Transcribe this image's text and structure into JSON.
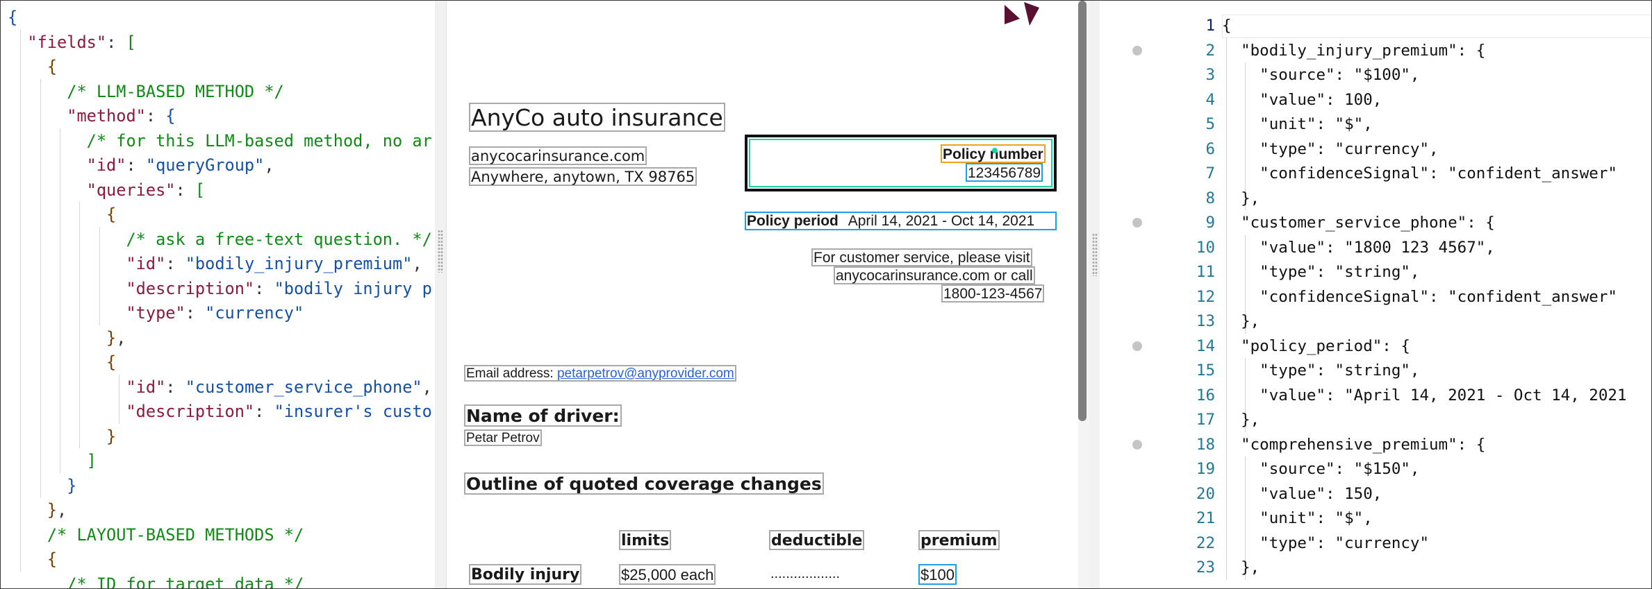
{
  "left_code": {
    "lines": [
      [
        {
          "c": "brace",
          "t": "{"
        }
      ],
      [
        {
          "c": "p",
          "t": "  "
        },
        {
          "c": "key",
          "t": "\"fields\""
        },
        {
          "c": "p",
          "t": ": "
        },
        {
          "c": "br2",
          "t": "["
        }
      ],
      [
        {
          "c": "p",
          "t": "    "
        },
        {
          "c": "br1",
          "t": "{"
        }
      ],
      [
        {
          "c": "p",
          "t": "      "
        },
        {
          "c": "cmt",
          "t": "/* LLM-BASED METHOD */"
        }
      ],
      [
        {
          "c": "p",
          "t": "      "
        },
        {
          "c": "key",
          "t": "\"method\""
        },
        {
          "c": "p",
          "t": ": "
        },
        {
          "c": "br3",
          "t": "{"
        }
      ],
      [
        {
          "c": "p",
          "t": "        "
        },
        {
          "c": "cmt",
          "t": "/* for this LLM-based method, no ar"
        }
      ],
      [
        {
          "c": "p",
          "t": "        "
        },
        {
          "c": "key",
          "t": "\"id\""
        },
        {
          "c": "p",
          "t": ": "
        },
        {
          "c": "str",
          "t": "\"queryGroup\""
        },
        {
          "c": "p",
          "t": ","
        }
      ],
      [
        {
          "c": "p",
          "t": "        "
        },
        {
          "c": "key",
          "t": "\"queries\""
        },
        {
          "c": "p",
          "t": ": "
        },
        {
          "c": "br2",
          "t": "["
        }
      ],
      [
        {
          "c": "p",
          "t": "          "
        },
        {
          "c": "br1",
          "t": "{"
        }
      ],
      [
        {
          "c": "p",
          "t": "            "
        },
        {
          "c": "cmt",
          "t": "/* ask a free-text question. */"
        }
      ],
      [
        {
          "c": "p",
          "t": "            "
        },
        {
          "c": "key",
          "t": "\"id\""
        },
        {
          "c": "p",
          "t": ": "
        },
        {
          "c": "str",
          "t": "\"bodily_injury_premium\""
        },
        {
          "c": "p",
          "t": ","
        }
      ],
      [
        {
          "c": "p",
          "t": "            "
        },
        {
          "c": "key",
          "t": "\"description\""
        },
        {
          "c": "p",
          "t": ": "
        },
        {
          "c": "str",
          "t": "\"bodily injury p"
        }
      ],
      [
        {
          "c": "p",
          "t": "            "
        },
        {
          "c": "key",
          "t": "\"type\""
        },
        {
          "c": "p",
          "t": ": "
        },
        {
          "c": "str",
          "t": "\"currency\""
        }
      ],
      [
        {
          "c": "p",
          "t": "          "
        },
        {
          "c": "br1",
          "t": "}"
        },
        {
          "c": "p",
          "t": ","
        }
      ],
      [
        {
          "c": "p",
          "t": "          "
        },
        {
          "c": "br1",
          "t": "{"
        }
      ],
      [
        {
          "c": "p",
          "t": "            "
        },
        {
          "c": "key",
          "t": "\"id\""
        },
        {
          "c": "p",
          "t": ": "
        },
        {
          "c": "str",
          "t": "\"customer_service_phone\""
        },
        {
          "c": "p",
          "t": ","
        }
      ],
      [
        {
          "c": "p",
          "t": "            "
        },
        {
          "c": "key",
          "t": "\"description\""
        },
        {
          "c": "p",
          "t": ": "
        },
        {
          "c": "str",
          "t": "\"insurer's custo"
        }
      ],
      [
        {
          "c": "p",
          "t": "          "
        },
        {
          "c": "br1",
          "t": "}"
        }
      ],
      [
        {
          "c": "p",
          "t": "        "
        },
        {
          "c": "br2",
          "t": "]"
        }
      ],
      [
        {
          "c": "p",
          "t": "      "
        },
        {
          "c": "br3",
          "t": "}"
        }
      ],
      [
        {
          "c": "p",
          "t": "    "
        },
        {
          "c": "br1",
          "t": "}"
        },
        {
          "c": "p",
          "t": ","
        }
      ],
      [
        {
          "c": "p",
          "t": "    "
        },
        {
          "c": "cmt",
          "t": "/* LAYOUT-BASED METHODS */"
        }
      ],
      [
        {
          "c": "p",
          "t": "    "
        },
        {
          "c": "br1",
          "t": "{"
        }
      ],
      [
        {
          "c": "p",
          "t": "      "
        },
        {
          "c": "cmt",
          "t": "/* ID for target data */"
        }
      ]
    ]
  },
  "document": {
    "company_name": "AnyCo auto insurance",
    "website": "anycocarinsurance.com",
    "address": "Anywhere, anytown, TX 98765",
    "policy_number_label": "Policy number",
    "policy_number_value": "123456789",
    "policy_period_label": "Policy period",
    "policy_period_value": "April 14, 2021 - Oct 14, 2021",
    "customer_service_line1": "For customer service, please visit",
    "customer_service_line2": "anycocarinsurance.com or call",
    "customer_service_line3": "1800-123-4567",
    "email_label": "Email address: ",
    "email_value": "petarpetrov@anyprovider.com",
    "driver_label": "Name of driver:",
    "driver_name": "Petar Petrov",
    "outline_heading": "Outline of quoted coverage changes",
    "table_headers": [
      "limits",
      "deductible",
      "premium"
    ],
    "row_label": "Bodily injury",
    "row_limits": "$25,000 each",
    "row_deductible": "..................",
    "row_premium": "$100",
    "colors": {
      "highlight_blue": "#1ea0e6",
      "highlight_orange": "#f0a020",
      "policy_box_green": "#1fd3a0",
      "logo": "#5a1030"
    }
  },
  "right_code": {
    "active_line": 1,
    "fold_lines": [
      2,
      9,
      14,
      18
    ],
    "lines": [
      {
        "n": 1,
        "t": "{"
      },
      {
        "n": 2,
        "t": "  \"bodily_injury_premium\": {"
      },
      {
        "n": 3,
        "t": "    \"source\": \"$100\","
      },
      {
        "n": 4,
        "t": "    \"value\": 100,"
      },
      {
        "n": 5,
        "t": "    \"unit\": \"$\","
      },
      {
        "n": 6,
        "t": "    \"type\": \"currency\","
      },
      {
        "n": 7,
        "t": "    \"confidenceSignal\": \"confident_answer\""
      },
      {
        "n": 8,
        "t": "  },"
      },
      {
        "n": 9,
        "t": "  \"customer_service_phone\": {"
      },
      {
        "n": 10,
        "t": "    \"value\": \"1800 123 4567\","
      },
      {
        "n": 11,
        "t": "    \"type\": \"string\","
      },
      {
        "n": 12,
        "t": "    \"confidenceSignal\": \"confident_answer\""
      },
      {
        "n": 13,
        "t": "  },"
      },
      {
        "n": 14,
        "t": "  \"policy_period\": {"
      },
      {
        "n": 15,
        "t": "    \"type\": \"string\","
      },
      {
        "n": 16,
        "t": "    \"value\": \"April 14, 2021 - Oct 14, 2021"
      },
      {
        "n": 17,
        "t": "  },"
      },
      {
        "n": 18,
        "t": "  \"comprehensive_premium\": {"
      },
      {
        "n": 19,
        "t": "    \"source\": \"$150\","
      },
      {
        "n": 20,
        "t": "    \"value\": 150,"
      },
      {
        "n": 21,
        "t": "    \"unit\": \"$\","
      },
      {
        "n": 22,
        "t": "    \"type\": \"currency\""
      },
      {
        "n": 23,
        "t": "  },"
      }
    ]
  }
}
